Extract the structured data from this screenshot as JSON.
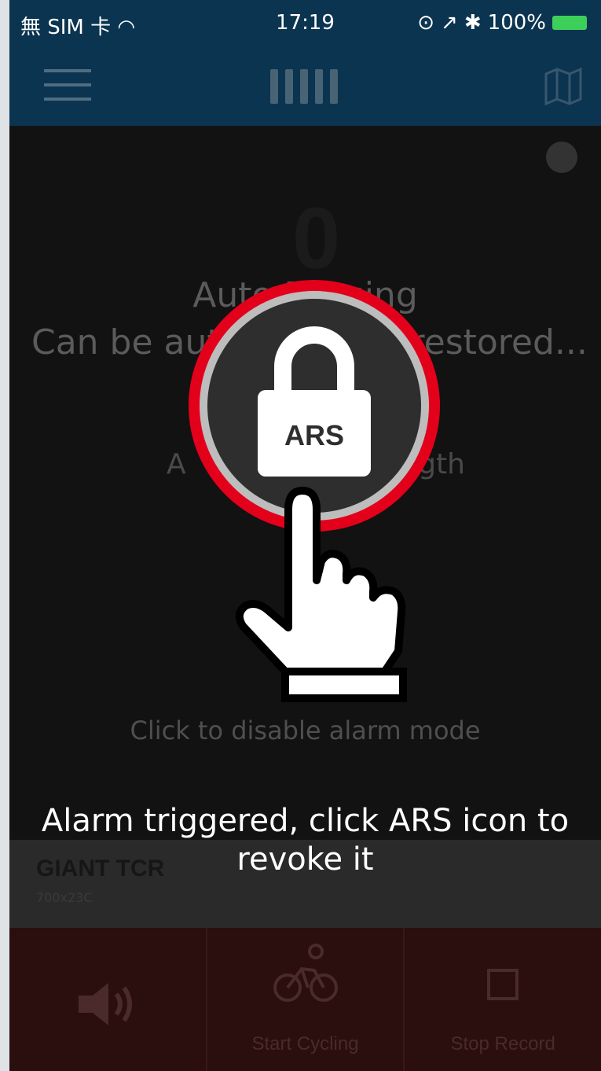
{
  "status_bar": {
    "carrier": "無 SIM 卡",
    "time": "17:19",
    "battery": "100%"
  },
  "content": {
    "big_value": "0",
    "auto_text": "Auto Pausing",
    "restore_text": "Can be automatically restored...",
    "length_left": "A",
    "length_right": "gth",
    "ars_label": "ARS",
    "click_disable": "Click to disable alarm mode",
    "overlay_line1": "Alarm triggered, click ARS icon to",
    "overlay_line2": "revoke it"
  },
  "bike": {
    "name": "GIANT TCR",
    "size": "700x23C"
  },
  "toolbar": {
    "start": "Start Cycling",
    "stop": "Stop Record"
  },
  "colors": {
    "nav_bg": "#0b3450",
    "ring_red": "#e3001b",
    "toolbar_bg": "#2b0e0e"
  }
}
